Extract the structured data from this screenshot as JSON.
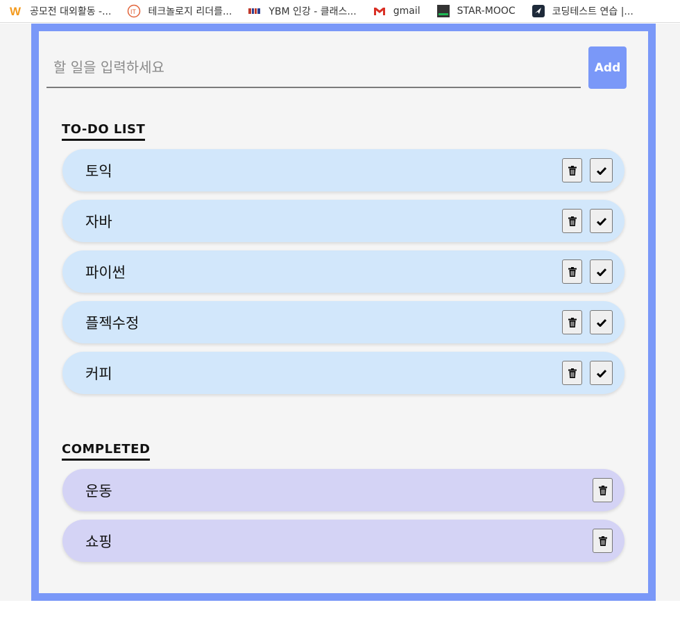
{
  "bookmarks": [
    {
      "icon": "wevity-w-icon",
      "label": "공모전 대외활동 -..."
    },
    {
      "icon": "it-circle-icon",
      "label": "테크놀로지 리더를..."
    },
    {
      "icon": "ybm-icon",
      "label": "YBM 인강 - 클래스..."
    },
    {
      "icon": "gmail-icon",
      "label": "gmail"
    },
    {
      "icon": "star-mooc-icon",
      "label": "STAR-MOOC"
    },
    {
      "icon": "coding-test-icon",
      "label": "코딩테스트 연습 |..."
    }
  ],
  "add_form": {
    "placeholder": "할 일을 입력하세요",
    "add_label": "Add"
  },
  "todo": {
    "title": "TO-DO LIST",
    "items": [
      "토익",
      "자바",
      "파이썬",
      "플젝수정",
      "커피"
    ]
  },
  "completed": {
    "title": "COMPLETED",
    "items": [
      "운동",
      "쇼핑"
    ]
  },
  "colors": {
    "accent": "#7a98f8",
    "todo_item_bg": "#d2e7fb",
    "completed_item_bg": "#d4d3f5"
  }
}
